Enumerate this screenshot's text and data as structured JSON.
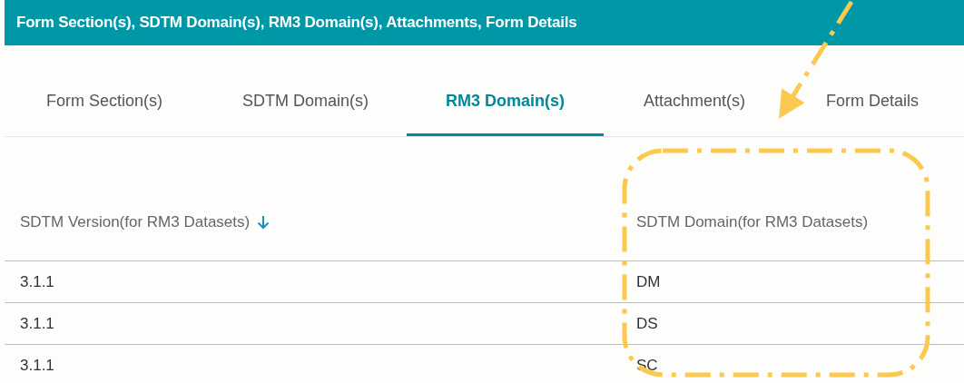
{
  "header": {
    "title": "Form Section(s), SDTM Domain(s), RM3 Domain(s), Attachments, Form Details"
  },
  "tabs": [
    {
      "label": "Form Section(s)",
      "selected": false
    },
    {
      "label": "SDTM Domain(s)",
      "selected": false
    },
    {
      "label": "RM3 Domain(s)",
      "selected": true
    },
    {
      "label": "Attachment(s)",
      "selected": false
    },
    {
      "label": "Form Details",
      "selected": false
    }
  ],
  "table": {
    "columns": [
      {
        "label": "SDTM Version(for RM3 Datasets)",
        "sorted_descending": true
      },
      {
        "label": "SDTM Domain(for RM3 Datasets)",
        "sorted_descending": false
      }
    ],
    "rows": [
      [
        "3.1.1",
        "DM"
      ],
      [
        "3.1.1",
        "DS"
      ],
      [
        "3.1.1",
        "SC"
      ]
    ]
  }
}
